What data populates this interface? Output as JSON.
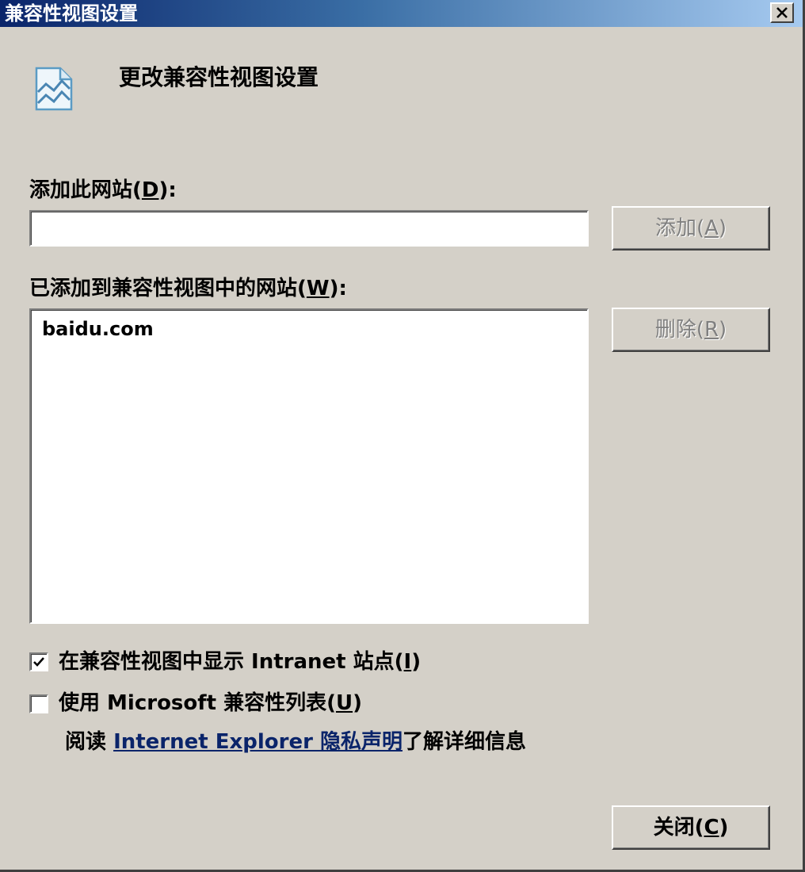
{
  "window": {
    "title": "兼容性视图设置",
    "close_symbol": "×"
  },
  "header": {
    "icon": "compat-view-page-icon",
    "heading": "更改兼容性视图设置"
  },
  "add_site": {
    "label_prefix": "添加此网站(",
    "label_key": "D",
    "label_suffix": "):",
    "input_value": "",
    "button_prefix": "添加(",
    "button_key": "A",
    "button_suffix": ")"
  },
  "added_sites": {
    "label_prefix": "已添加到兼容性视图中的网站(",
    "label_key": "W",
    "label_suffix": "):",
    "items": [
      "baidu.com"
    ],
    "remove_prefix": "删除(",
    "remove_key": "R",
    "remove_suffix": ")"
  },
  "options": {
    "intranet": {
      "checked": true,
      "label_prefix": "在兼容性视图中显示 Intranet 站点(",
      "label_key": "I",
      "label_suffix": ")"
    },
    "ms_list": {
      "checked": false,
      "label_prefix": "使用 Microsoft 兼容性列表(",
      "label_key": "U",
      "label_suffix": ")"
    }
  },
  "info": {
    "before": "阅读 ",
    "link_text": "Internet Explorer 隐私声明",
    "after": "了解详细信息"
  },
  "footer": {
    "close_prefix": "关闭(",
    "close_key": "C",
    "close_suffix": ")"
  },
  "colors": {
    "face": "#d4d0c8",
    "title_start": "#0a246a",
    "title_end": "#a6caf0",
    "link": "#0a246a",
    "disabled_text": "#808080"
  }
}
